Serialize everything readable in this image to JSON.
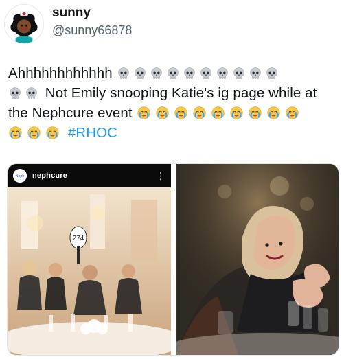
{
  "tweet": {
    "display_name": "sunny",
    "handle": "@sunny66878",
    "text_intro": "Ahhhhhhhhhhhh",
    "text_middle": "Not Emily snooping Katie's ig page while at the Nephcure event",
    "hashtag": "#RHOC",
    "emoji": {
      "skull_icon": "skull-emoji",
      "cry_icon": "loudly-crying-face-emoji"
    }
  },
  "media": {
    "left_photo": {
      "account_name": "nephcure",
      "account_avatar_text": "Neph",
      "paddle_number": "274"
    }
  },
  "colors": {
    "text": "#0f1419",
    "secondary": "#536471",
    "hashtag": "#1d9bf0"
  }
}
